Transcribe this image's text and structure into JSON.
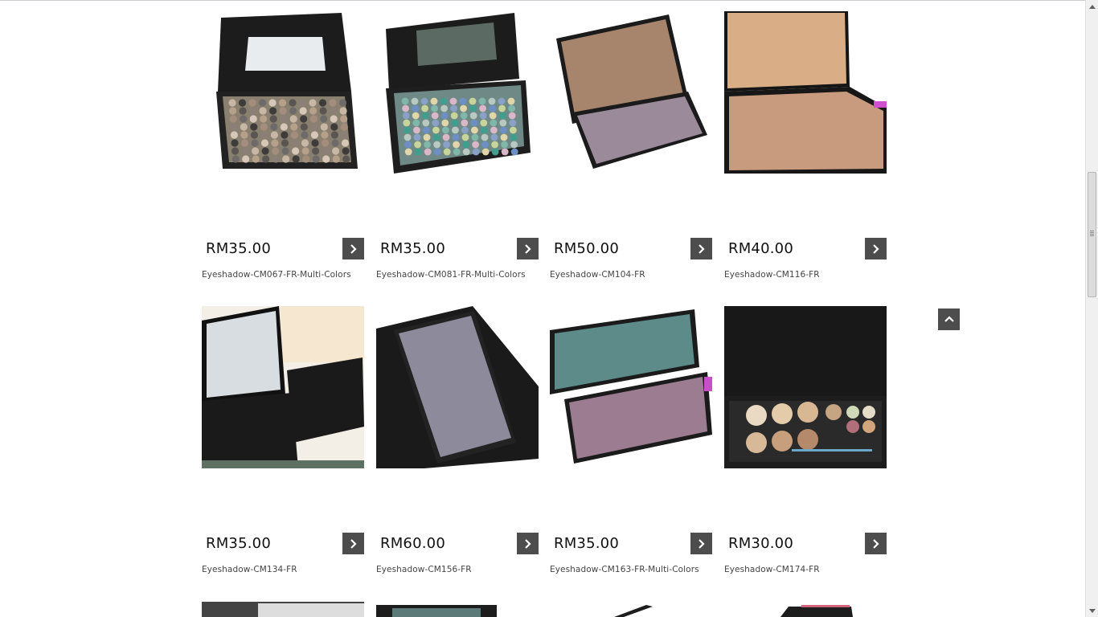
{
  "products": [
    {
      "price": "RM35.00",
      "name": "Eyeshadow-CM067-FR-Multi-Colors"
    },
    {
      "price": "RM35.00",
      "name": "Eyeshadow-CM081-FR-Multi-Colors"
    },
    {
      "price": "RM50.00",
      "name": "Eyeshadow-CM104-FR"
    },
    {
      "price": "RM40.00",
      "name": "Eyeshadow-CM116-FR"
    },
    {
      "price": "RM35.00",
      "name": "Eyeshadow-CM134-FR"
    },
    {
      "price": "RM60.00",
      "name": "Eyeshadow-CM156-FR"
    },
    {
      "price": "RM35.00",
      "name": "Eyeshadow-CM163-FR-Multi-Colors"
    },
    {
      "price": "RM30.00",
      "name": "Eyeshadow-CM174-FR"
    }
  ],
  "icons": {
    "product_button": "chevron-right-icon",
    "back_to_top": "chevron-up-icon"
  },
  "colors": {
    "button_bg": "#4d4d4d",
    "palette_case": "#1a1a1a"
  }
}
